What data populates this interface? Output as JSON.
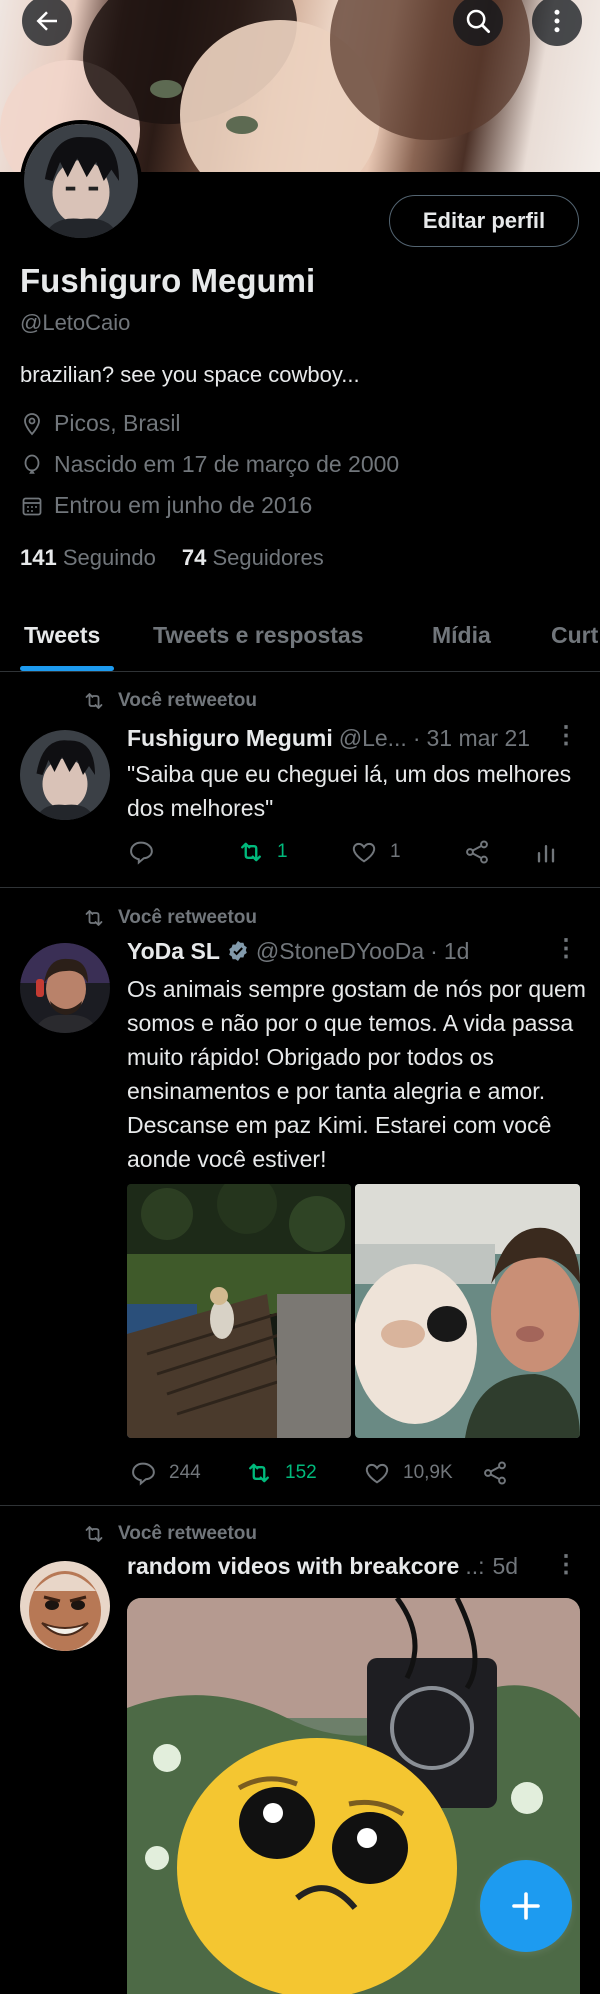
{
  "header": {
    "back_icon": "arrow-left-icon",
    "search_icon": "search-icon",
    "more_icon": "more-vertical-icon"
  },
  "profile": {
    "edit_label": "Editar perfil",
    "name": "Fushiguro Megumi",
    "handle": "@LetoCaio",
    "bio": "brazilian? see you space cowboy...",
    "location": "Picos, Brasil",
    "birth": "Nascido em 17 de março de 2000",
    "joined": "Entrou em junho de 2016",
    "following_count": "141",
    "following_label": "Seguindo",
    "followers_count": "74",
    "followers_label": "Seguidores"
  },
  "tabs": [
    {
      "label": "Tweets"
    },
    {
      "label": "Tweets e respostas"
    },
    {
      "label": "Mídia"
    },
    {
      "label": "Curt"
    }
  ],
  "tweets": [
    {
      "retweet_label": "Você retweetou",
      "name": "Fushiguro Megumi",
      "handle": "@Le...",
      "dot": "·",
      "time": "31 mar 21",
      "text": "\"Saiba que eu cheguei lá, um dos melhores dos melhores\"",
      "replies": "",
      "retweets": "1",
      "likes": "1"
    },
    {
      "retweet_label": "Você retweetou",
      "name": "YoDa SL",
      "handle": "@StoneDYooDa",
      "dot": "·",
      "time": "1d",
      "text": "Os animais sempre gostam de nós por quem somos e não por o que temos. A vida passa muito rápido! Obrigado por todos os ensinamentos e por tanta alegria e amor. Descanse em paz Kimi. Estarei com você aonde você estiver!",
      "replies": "244",
      "retweets": "152",
      "likes": "10,9K"
    },
    {
      "retweet_label": "Você retweetou",
      "name": "random videos with breakcore",
      "handle": "..:",
      "time": "5d"
    }
  ],
  "colors": {
    "accent": "#1d9bf0",
    "retweet_green": "#00ba7c",
    "muted": "#71767b",
    "background": "#000000"
  }
}
